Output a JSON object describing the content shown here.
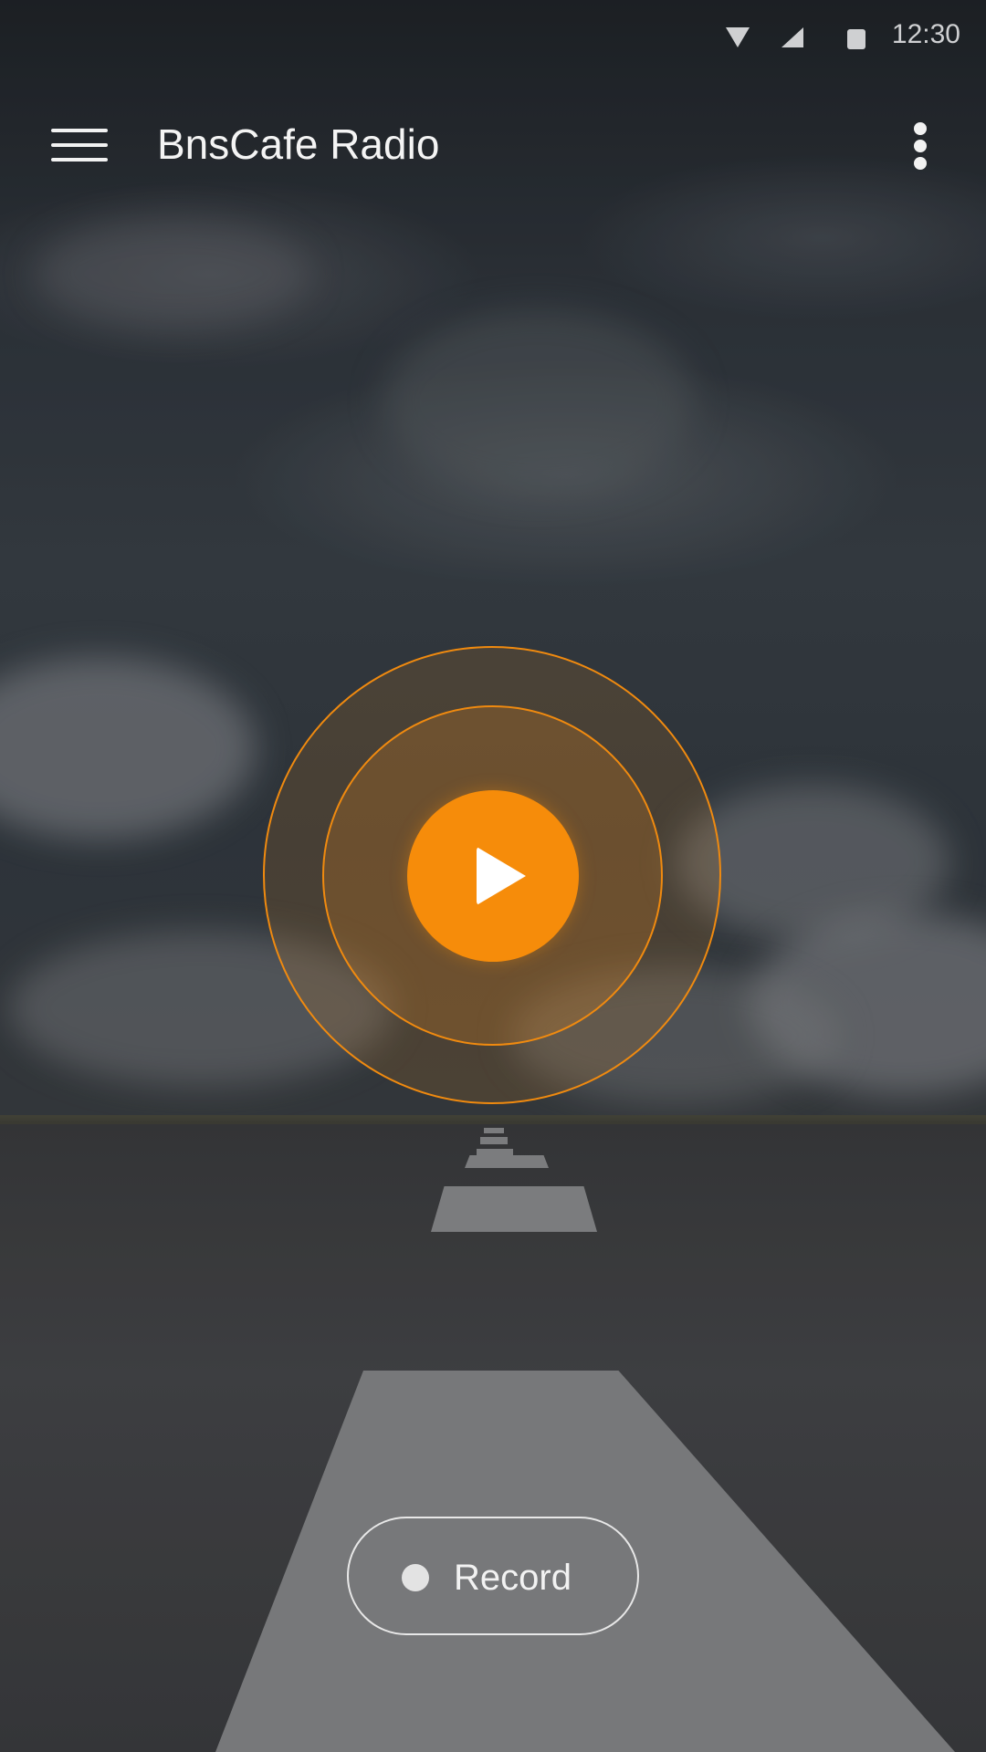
{
  "status_bar": {
    "time": "12:30",
    "icons": [
      "wifi-icon",
      "cell-signal-icon",
      "battery-icon"
    ]
  },
  "app_bar": {
    "title": "BnsCafe Radio",
    "left_icon": "menu-icon",
    "right_icon": "more-vert-icon"
  },
  "player": {
    "play_icon": "play-icon",
    "accent_color": "#f68c0a"
  },
  "record": {
    "label": "Record",
    "icon": "record-dot-icon"
  }
}
